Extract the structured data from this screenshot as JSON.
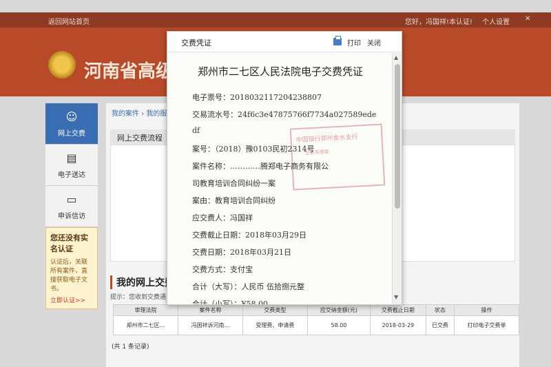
{
  "topbar": {
    "home": "返回网站首页",
    "user": "您好，冯国祥!本认证!",
    "settings": "个人设置",
    "close": "✕"
  },
  "header": {
    "title": "河南省高级"
  },
  "sidebar": {
    "items": [
      {
        "label": "网上交费",
        "icon": "user-icon"
      },
      {
        "label": "电子送达",
        "icon": "document-icon"
      },
      {
        "label": "申诉信访",
        "icon": "message-icon"
      }
    ],
    "note": {
      "title": "您还没有实名认证",
      "text": "认证后，关联所有案件，直接获取电子文书。",
      "link": "立即认证>>"
    }
  },
  "main": {
    "breadcrumb": "我的案件 › 我的服",
    "flow_title": "网上交费流程",
    "my_title": "我的网上交费",
    "hint": "提示：您收到交费通",
    "table": {
      "headers": [
        "审理法院",
        "案件名称",
        "交费类型",
        "应交纳金额(元)",
        "交费截止日期",
        "状态",
        "操作"
      ],
      "rows": [
        [
          "郑州市二七区…",
          "冯国祥诉河南…",
          "受理费、申请费",
          "58.00",
          "2018-03-29",
          "已交费",
          "打印电子交费单"
        ]
      ]
    },
    "total": "(共 1 条记录)"
  },
  "modal": {
    "title": "交费凭证",
    "print": "打印",
    "close": "关闭",
    "voucher_title": "郑州市二七区人民法院电子交费凭证",
    "lines": [
      "电子票号：20180321172042388​07",
      "交易流水号：24f6c3e47875766f7734a027589ede",
      "df",
      "案号：（2018）豫0103民初2314号",
      "案件名称：…………腾郑电子商务有限公",
      "司教育培训合同纠纷一案",
      "案由：教育培训合同纠纷",
      "应交费人：冯国祥",
      "交费截止日期：2018年03月29日",
      "交费日期：2018年03月21日",
      "交费方式：支付宝",
      "合计（大写）：人民币  伍拾捌元整",
      "合计（小写）：¥58.00"
    ],
    "stamp": {
      "line1": "中国银行郑州金水支行",
      "line2": "业务专用章"
    }
  }
}
